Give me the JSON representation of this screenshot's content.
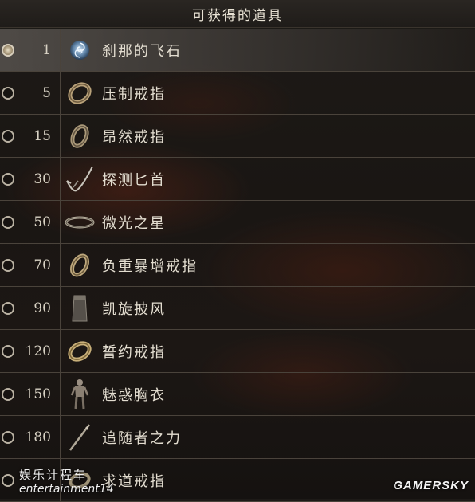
{
  "header": {
    "title": "可获得的道具"
  },
  "items": [
    {
      "cost": "1",
      "name": "刹那的飞石",
      "icon": "swirl-stone-icon",
      "selected": true
    },
    {
      "cost": "5",
      "name": "压制戒指",
      "icon": "ring-icon"
    },
    {
      "cost": "15",
      "name": "昂然戒指",
      "icon": "ring-icon"
    },
    {
      "cost": "30",
      "name": "探测匕首",
      "icon": "dagger-icon"
    },
    {
      "cost": "50",
      "name": "微光之星",
      "icon": "circlet-icon"
    },
    {
      "cost": "70",
      "name": "负重暴增戒指",
      "icon": "ring-icon"
    },
    {
      "cost": "90",
      "name": "凯旋披风",
      "icon": "cloak-icon"
    },
    {
      "cost": "120",
      "name": "誓约戒指",
      "icon": "ring-icon"
    },
    {
      "cost": "150",
      "name": "魅惑胸衣",
      "icon": "armor-figure-icon"
    },
    {
      "cost": "180",
      "name": "追随者之力",
      "icon": "spear-icon"
    },
    {
      "cost": "",
      "name": "求道戒指",
      "icon": "ring-icon"
    }
  ],
  "watermarks": {
    "left_cn": "娱乐计程车",
    "left_en": "entertainment14",
    "right": "GAMERSKY"
  }
}
